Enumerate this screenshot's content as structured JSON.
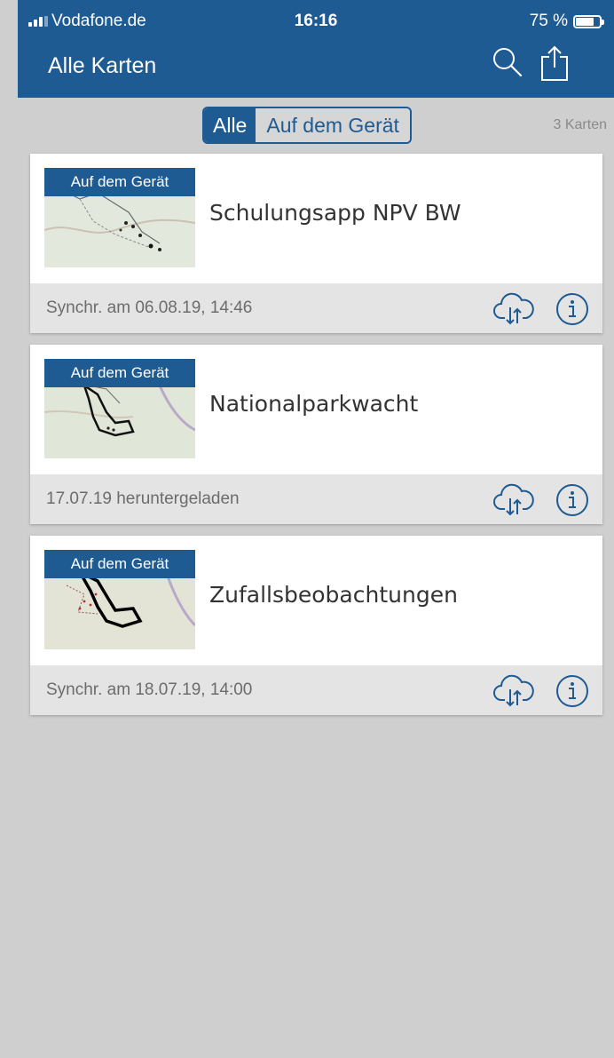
{
  "status_bar": {
    "carrier": "Vodafone.de",
    "time": "16:16",
    "battery_text": "75 %",
    "battery_level": 0.75
  },
  "nav": {
    "title": "Alle Karten",
    "icons": [
      "search-icon",
      "share-icon"
    ]
  },
  "filter": {
    "segments": [
      "Alle",
      "Auf dem Gerät"
    ],
    "selected": "Alle",
    "count_text": "3 Karten"
  },
  "cards": [
    {
      "badge": "Auf dem Gerät",
      "title": "Schulungsapp NPV BW",
      "footer": "Synchr. am 06.08.19, 14:46"
    },
    {
      "badge": "Auf dem Gerät",
      "title": "Nationalparkwacht",
      "footer": "17.07.19 heruntergeladen"
    },
    {
      "badge": "Auf dem Gerät",
      "title": "Zufallsbeobachtungen",
      "footer": "Synchr. am 18.07.19, 14:00"
    }
  ],
  "colors": {
    "brand": "#1f5b93",
    "background": "#cfcfcf",
    "footer": "#e4e4e4"
  }
}
